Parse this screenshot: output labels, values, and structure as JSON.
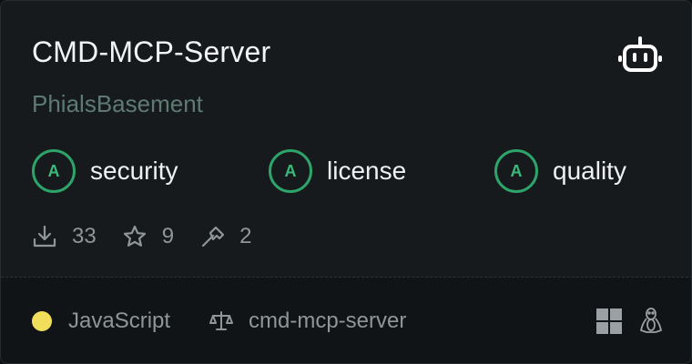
{
  "card": {
    "title": "CMD-MCP-Server",
    "owner": "PhialsBasement",
    "type_icon": "robot-icon"
  },
  "grades": [
    {
      "letter": "A",
      "label": "security"
    },
    {
      "letter": "A",
      "label": "license"
    },
    {
      "letter": "A",
      "label": "quality"
    }
  ],
  "stats": {
    "downloads": "33",
    "stars": "9",
    "tools": "2"
  },
  "footer": {
    "language": "JavaScript",
    "language_color": "#f1df5c",
    "package": "cmd-mcp-server",
    "platforms": [
      "windows-icon",
      "linux-icon"
    ]
  },
  "colors": {
    "grade_accent": "#2ea36a",
    "owner_text": "#5f7a72"
  }
}
